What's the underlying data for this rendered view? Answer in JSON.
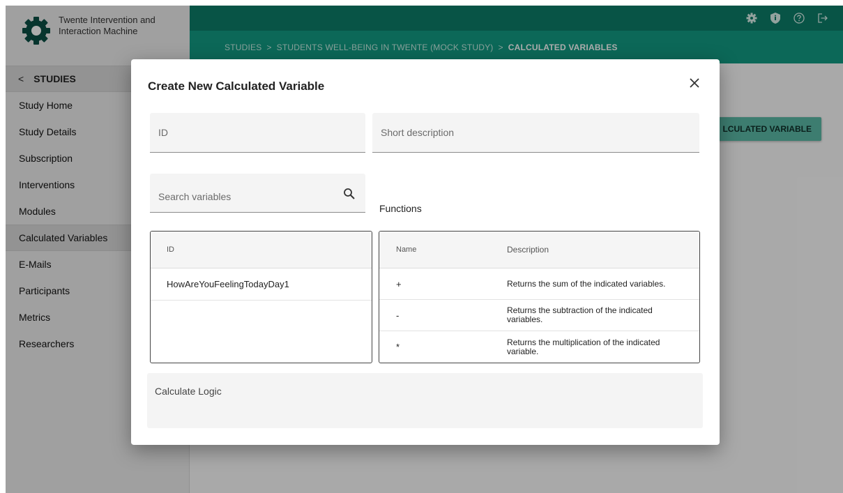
{
  "brand": {
    "title": "Twente Intervention and",
    "subtitle": "Interaction Machine"
  },
  "sidebar": {
    "back_label": "STUDIES",
    "items": [
      {
        "label": "Study Home"
      },
      {
        "label": "Study Details"
      },
      {
        "label": "Subscription"
      },
      {
        "label": "Interventions"
      },
      {
        "label": "Modules"
      },
      {
        "label": "Calculated Variables",
        "active": true
      },
      {
        "label": "E-Mails"
      },
      {
        "label": "Participants"
      },
      {
        "label": "Metrics"
      },
      {
        "label": "Researchers"
      }
    ]
  },
  "topbar": {
    "icons": [
      "gear-icon",
      "shield-icon",
      "help-icon",
      "logout-icon"
    ]
  },
  "breadcrumb": {
    "items": [
      "STUDIES",
      "STUDENTS WELL-BEING IN TWENTE (MOCK STUDY)",
      "CALCULATED VARIABLES"
    ],
    "separator": ">"
  },
  "content": {
    "create_button_label": "LCULATED VARIABLE"
  },
  "dialog": {
    "title": "Create New Calculated Variable",
    "id_placeholder": "ID",
    "description_placeholder": "Short description",
    "search_placeholder": "Search variables",
    "functions_label": "Functions",
    "variables_table": {
      "header": "ID",
      "rows": [
        "HowAreYouFeelingTodayDay1"
      ]
    },
    "functions_table": {
      "headers": [
        "Name",
        "Description"
      ],
      "rows": [
        {
          "name": "+",
          "description": "Returns the sum of the indicated variables."
        },
        {
          "name": "-",
          "description": "Returns the subtraction of the indicated variables."
        },
        {
          "name": "*",
          "description": "Returns the multiplication of the indicated variable."
        }
      ]
    },
    "logic_placeholder": "Calculate Logic"
  },
  "colors": {
    "primary_dark": "#0d7c67",
    "primary": "#129a82",
    "accent_button": "#5ab8a6"
  }
}
